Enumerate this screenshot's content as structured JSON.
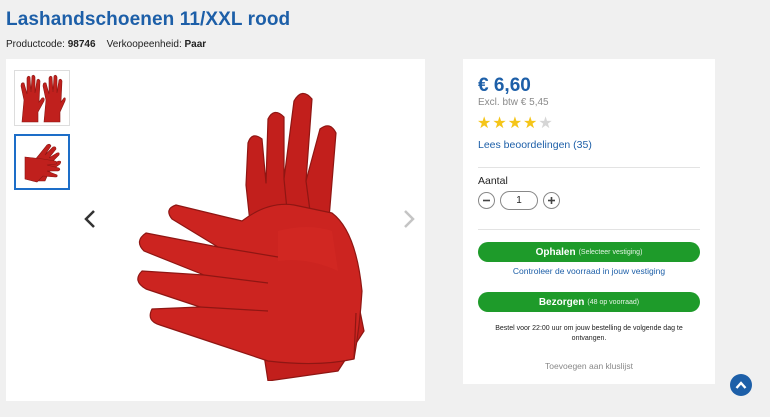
{
  "product": {
    "title": "Lashandschoenen 11/XXL rood",
    "code_label": "Productcode:",
    "code": "98746",
    "unit_label": "Verkoopeenheid:",
    "unit": "Paar"
  },
  "pricing": {
    "price": "€ 6,60",
    "excl": "Excl. btw € 5,45"
  },
  "rating": {
    "stars": 4,
    "max": 5,
    "reviews_link": "Lees beoordelingen (35)"
  },
  "quantity": {
    "label": "Aantal",
    "value": "1"
  },
  "actions": {
    "pickup_label": "Ophalen",
    "pickup_sub": "(Selecteer vestiging)",
    "stock_link": "Controleer de voorraad in jouw vestiging",
    "deliver_label": "Bezorgen",
    "deliver_sub": "(48 op voorraad)",
    "delivery_note": "Bestel voor 22:00 uur om jouw bestelling de volgende dag te ontvangen.",
    "add_to_list": "Toevoegen aan kluslijst"
  },
  "icons": {
    "prev": "chevron-left-icon",
    "next": "chevron-right-icon",
    "minus": "minus-icon",
    "plus": "plus-icon",
    "back_to_top": "chevron-up-icon"
  },
  "colors": {
    "brand_blue": "#1d5fa8",
    "action_green": "#1e9b2a",
    "star": "#f5c518",
    "glove_red": "#c0201d"
  }
}
